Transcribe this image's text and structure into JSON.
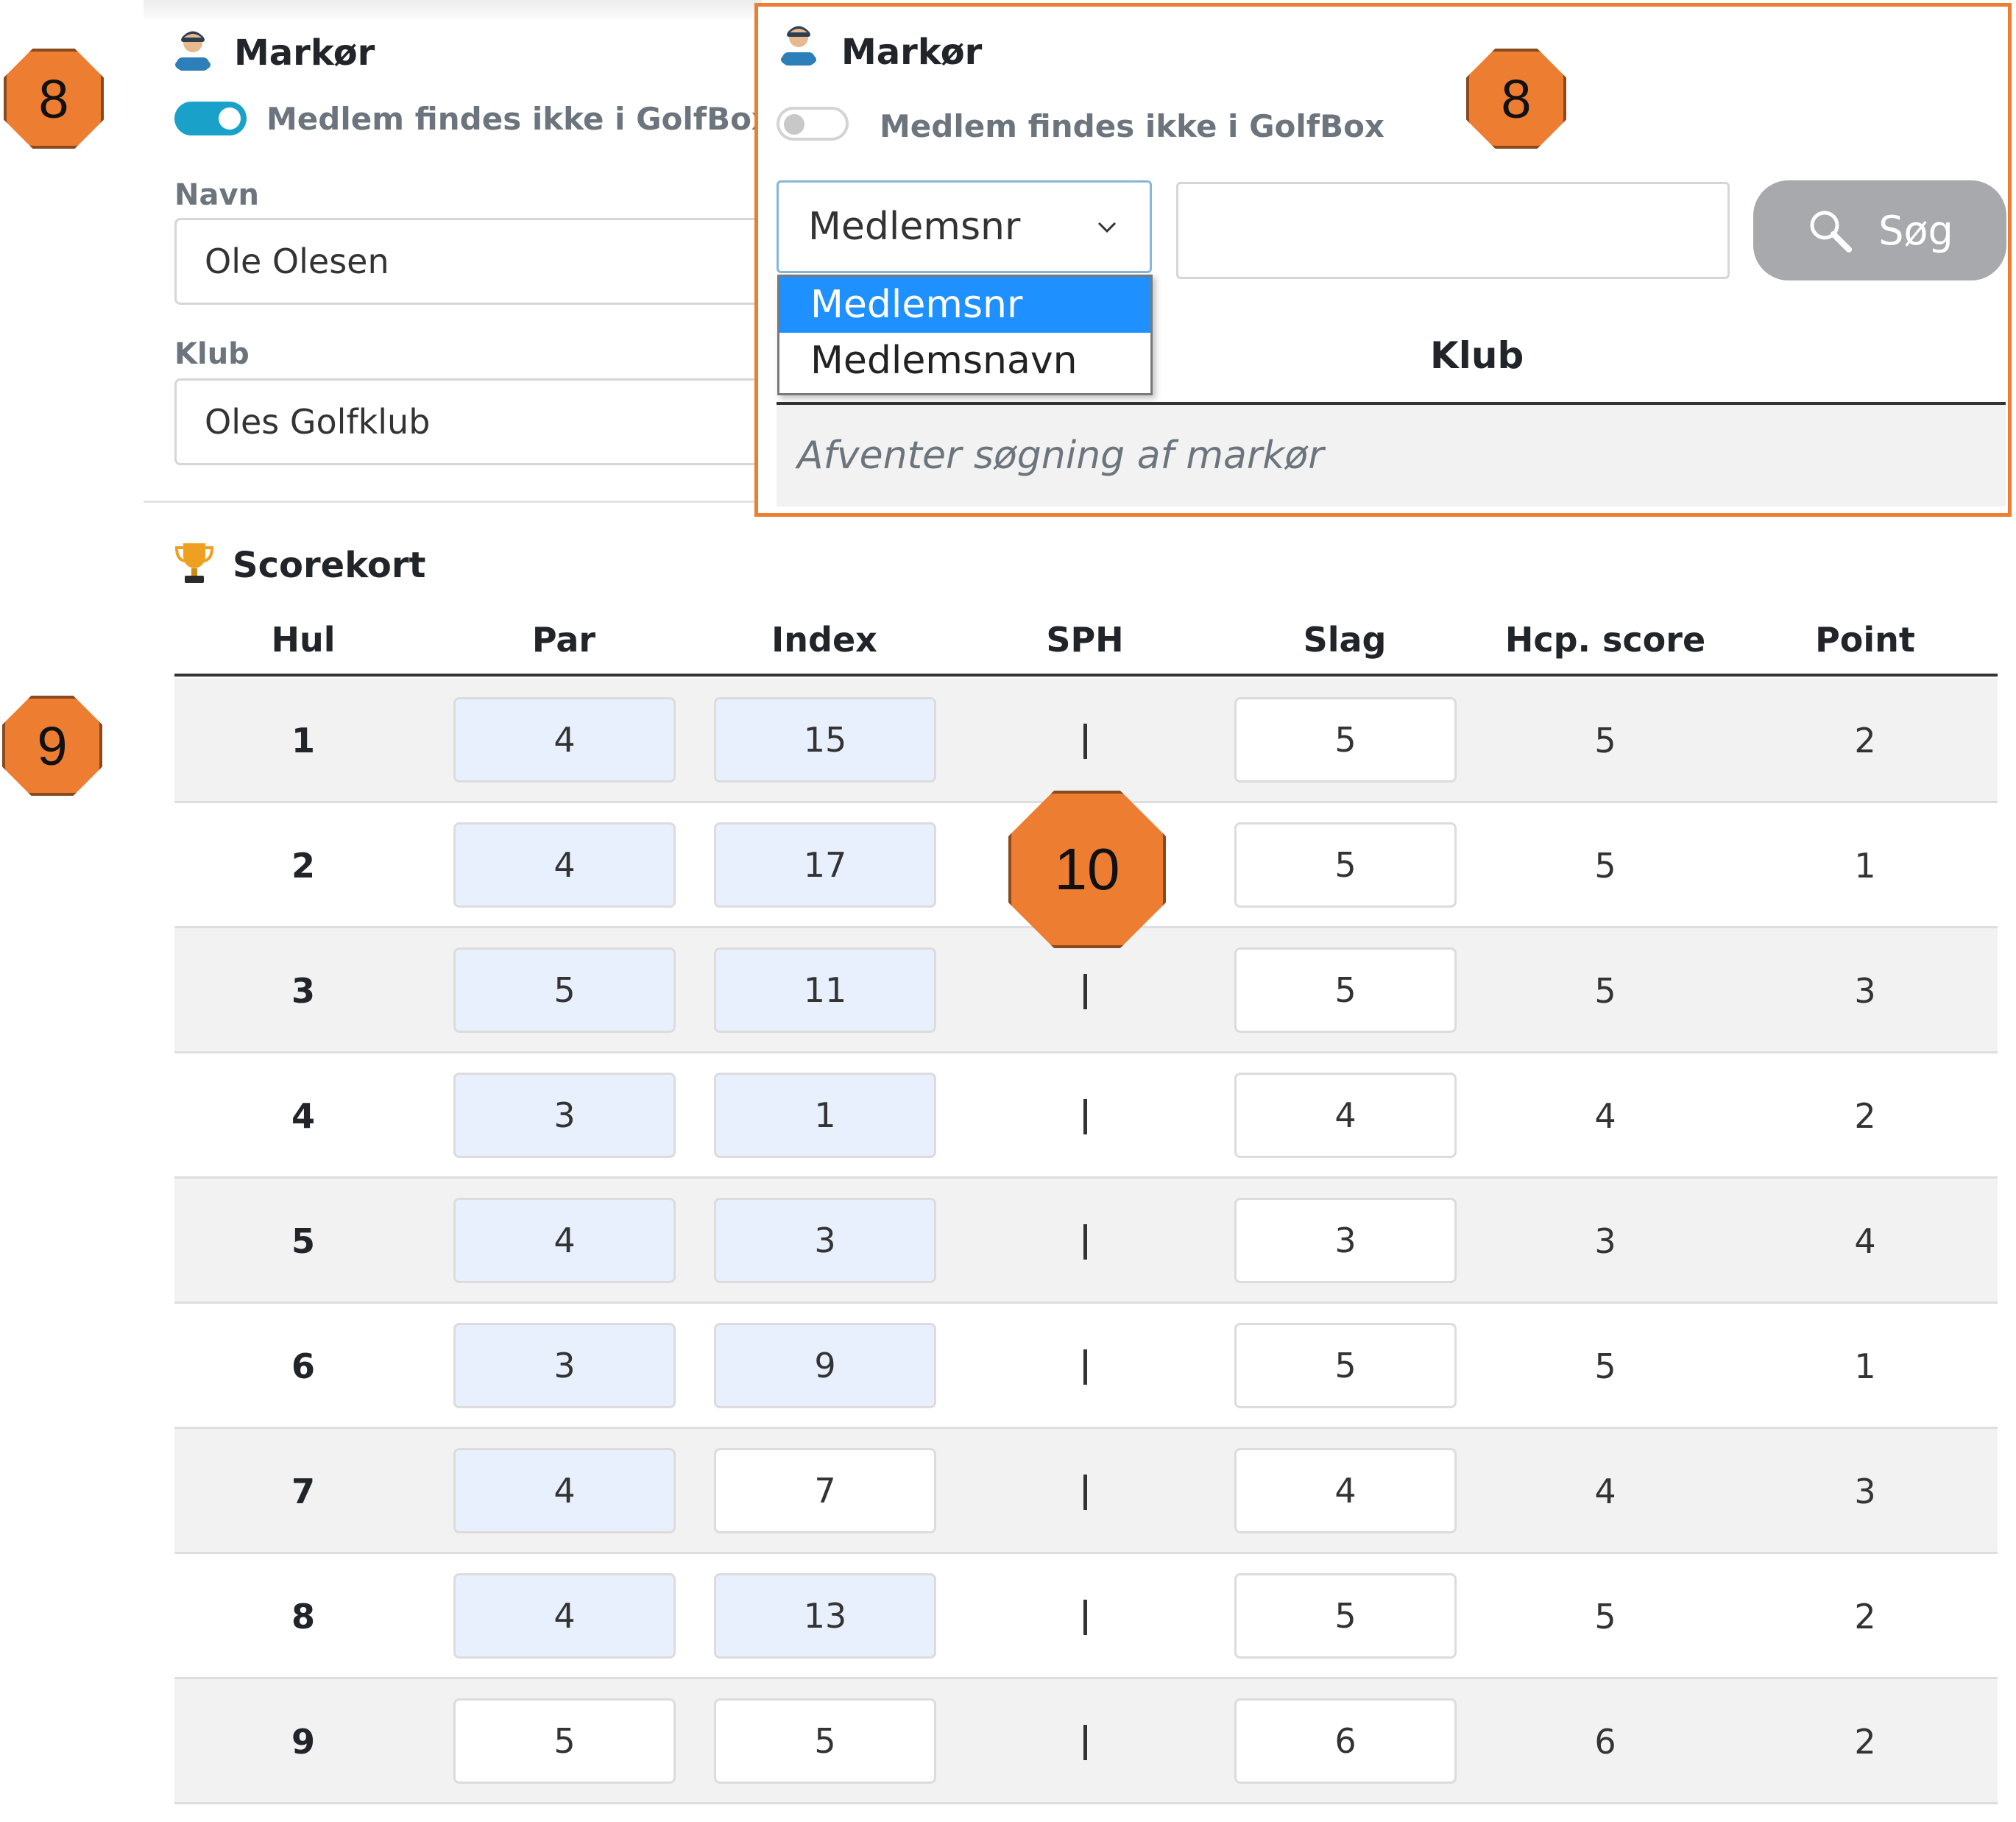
{
  "left_panel": {
    "title": "Markør",
    "toggle_label": "Medlem findes ikke i GolfBox",
    "toggle_on": true,
    "name_label": "Navn",
    "name_value": "Ole Olesen",
    "club_label": "Klub",
    "club_value": "Oles Golfklub"
  },
  "right_panel": {
    "title": "Markør",
    "toggle_label": "Medlem findes ikke i GolfBox",
    "toggle_on": false,
    "select_value": "Medlemsnr",
    "select_options": [
      "Medlemsnr",
      "Medlemsnavn"
    ],
    "search_input_value": "",
    "search_button_label": "Søg",
    "column_club": "Klub",
    "awaiting_text": "Afventer søgning af markør"
  },
  "scorecard": {
    "title": "Scorekort",
    "columns": [
      "Hul",
      "Par",
      "Index",
      "SPH",
      "Slag",
      "Hcp. score",
      "Point"
    ],
    "rows": [
      {
        "hole": "1",
        "par": "4",
        "index": "15",
        "sph": "|",
        "slag": "5",
        "hcp_score": "5",
        "point": "2"
      },
      {
        "hole": "2",
        "par": "4",
        "index": "17",
        "sph": "|",
        "slag": "5",
        "hcp_score": "5",
        "point": "1"
      },
      {
        "hole": "3",
        "par": "5",
        "index": "11",
        "sph": "|",
        "slag": "5",
        "hcp_score": "5",
        "point": "3"
      },
      {
        "hole": "4",
        "par": "3",
        "index": "1",
        "sph": "|",
        "slag": "4",
        "hcp_score": "4",
        "point": "2"
      },
      {
        "hole": "5",
        "par": "4",
        "index": "3",
        "sph": "|",
        "slag": "3",
        "hcp_score": "3",
        "point": "4"
      },
      {
        "hole": "6",
        "par": "3",
        "index": "9",
        "sph": "|",
        "slag": "5",
        "hcp_score": "5",
        "point": "1"
      },
      {
        "hole": "7",
        "par": "4",
        "index": "7",
        "sph": "|",
        "slag": "4",
        "hcp_score": "4",
        "point": "3"
      },
      {
        "hole": "8",
        "par": "4",
        "index": "13",
        "sph": "|",
        "slag": "5",
        "hcp_score": "5",
        "point": "2"
      },
      {
        "hole": "9",
        "par": "5",
        "index": "5",
        "sph": "|",
        "slag": "6",
        "hcp_score": "6",
        "point": "2"
      }
    ]
  },
  "callouts": [
    "8",
    "8",
    "9",
    "10"
  ],
  "colors": {
    "accent_toggle": "#1aa1c9",
    "callout_orange": "#ed7d31",
    "highlight_frame": "#ed7d31",
    "prefilled_input": "#e8f0fe",
    "dropdown_selected": "#1e90ff",
    "search_button": "#a7a9ac"
  },
  "icons": {
    "section_marker": "person-icon",
    "section_scorecard": "trophy-icon",
    "select_caret": "chevron-down-icon",
    "search": "magnifier-icon"
  }
}
